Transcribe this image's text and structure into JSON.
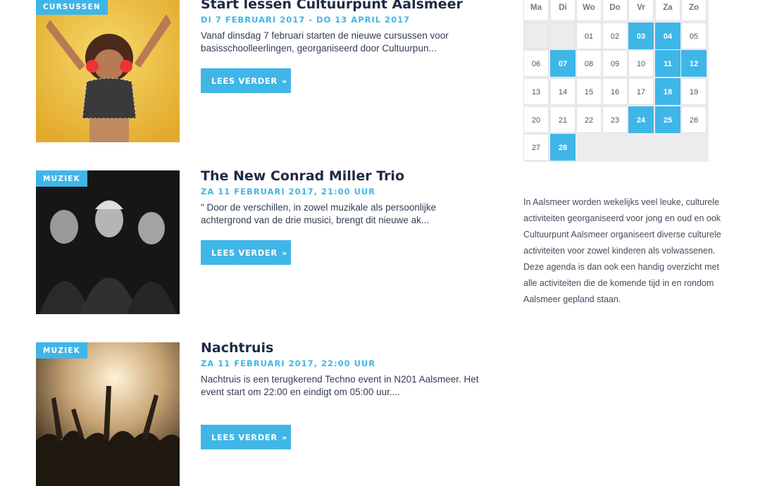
{
  "events": [
    {
      "category": "CURSUSSEN",
      "title": "Start lessen Cultuurpunt Aalsmeer",
      "date": "DI 7 FEBRUARI 2017 - DO 13 APRIL 2017",
      "description": "Vanaf dinsdag 7 februari starten de nieuwe cursussen voor basisschoolleerlingen, georganiseerd door Cultuurpun...",
      "read_more": "LEES VERDER"
    },
    {
      "category": "MUZIEK",
      "title": "The New Conrad Miller Trio",
      "date": "ZA 11 FEBRUARI 2017, 21:00 UUR",
      "description": "\" Door de verschillen, in zowel muzikale als persoonlijke achtergrond van de drie musici, brengt dit nieuwe ak...",
      "read_more": "LEES VERDER"
    },
    {
      "category": "MUZIEK",
      "title": "Nachtruis",
      "date": "ZA 11 FEBRUARI 2017, 22:00 UUR",
      "description": "Nachtruis is een terugkerend Techno event in N201 Aalsmeer. Het event start om 22:00 en eindigt om 05:00 uur....",
      "read_more": "LEES VERDER"
    }
  ],
  "calendar": {
    "weekdays": [
      "Ma",
      "Di",
      "Wo",
      "Do",
      "Vr",
      "Za",
      "Zo"
    ],
    "weeks": [
      [
        "",
        "",
        "01",
        "02",
        "03",
        "04",
        "05"
      ],
      [
        "06",
        "07",
        "08",
        "09",
        "10",
        "11",
        "12"
      ],
      [
        "13",
        "14",
        "15",
        "16",
        "17",
        "18",
        "19"
      ],
      [
        "20",
        "21",
        "22",
        "23",
        "24",
        "25",
        "26"
      ],
      [
        "27",
        "28",
        "",
        "",
        "",
        "",
        ""
      ]
    ],
    "highlighted_days": [
      "03",
      "04",
      "07",
      "11",
      "12",
      "18",
      "24",
      "25",
      "28"
    ]
  },
  "intro": "In Aalsmeer worden wekelijks veel leuke, culturele activiteiten georganiseerd voor jong en oud en ook Cultuurpunt Aalsmeer organiseert diverse culturele activiteiten voor zowel kinderen als volwassenen. Deze agenda is dan ook een handig overzicht met alle activiteiten die de komende tijd in en rondom Aalsmeer gepland staan.",
  "colors": {
    "accent": "#3fb6e8",
    "title": "#1f2a44",
    "calendar_bg": "#ececec"
  },
  "icons": {
    "read_more": "double-chevron-right-icon"
  }
}
